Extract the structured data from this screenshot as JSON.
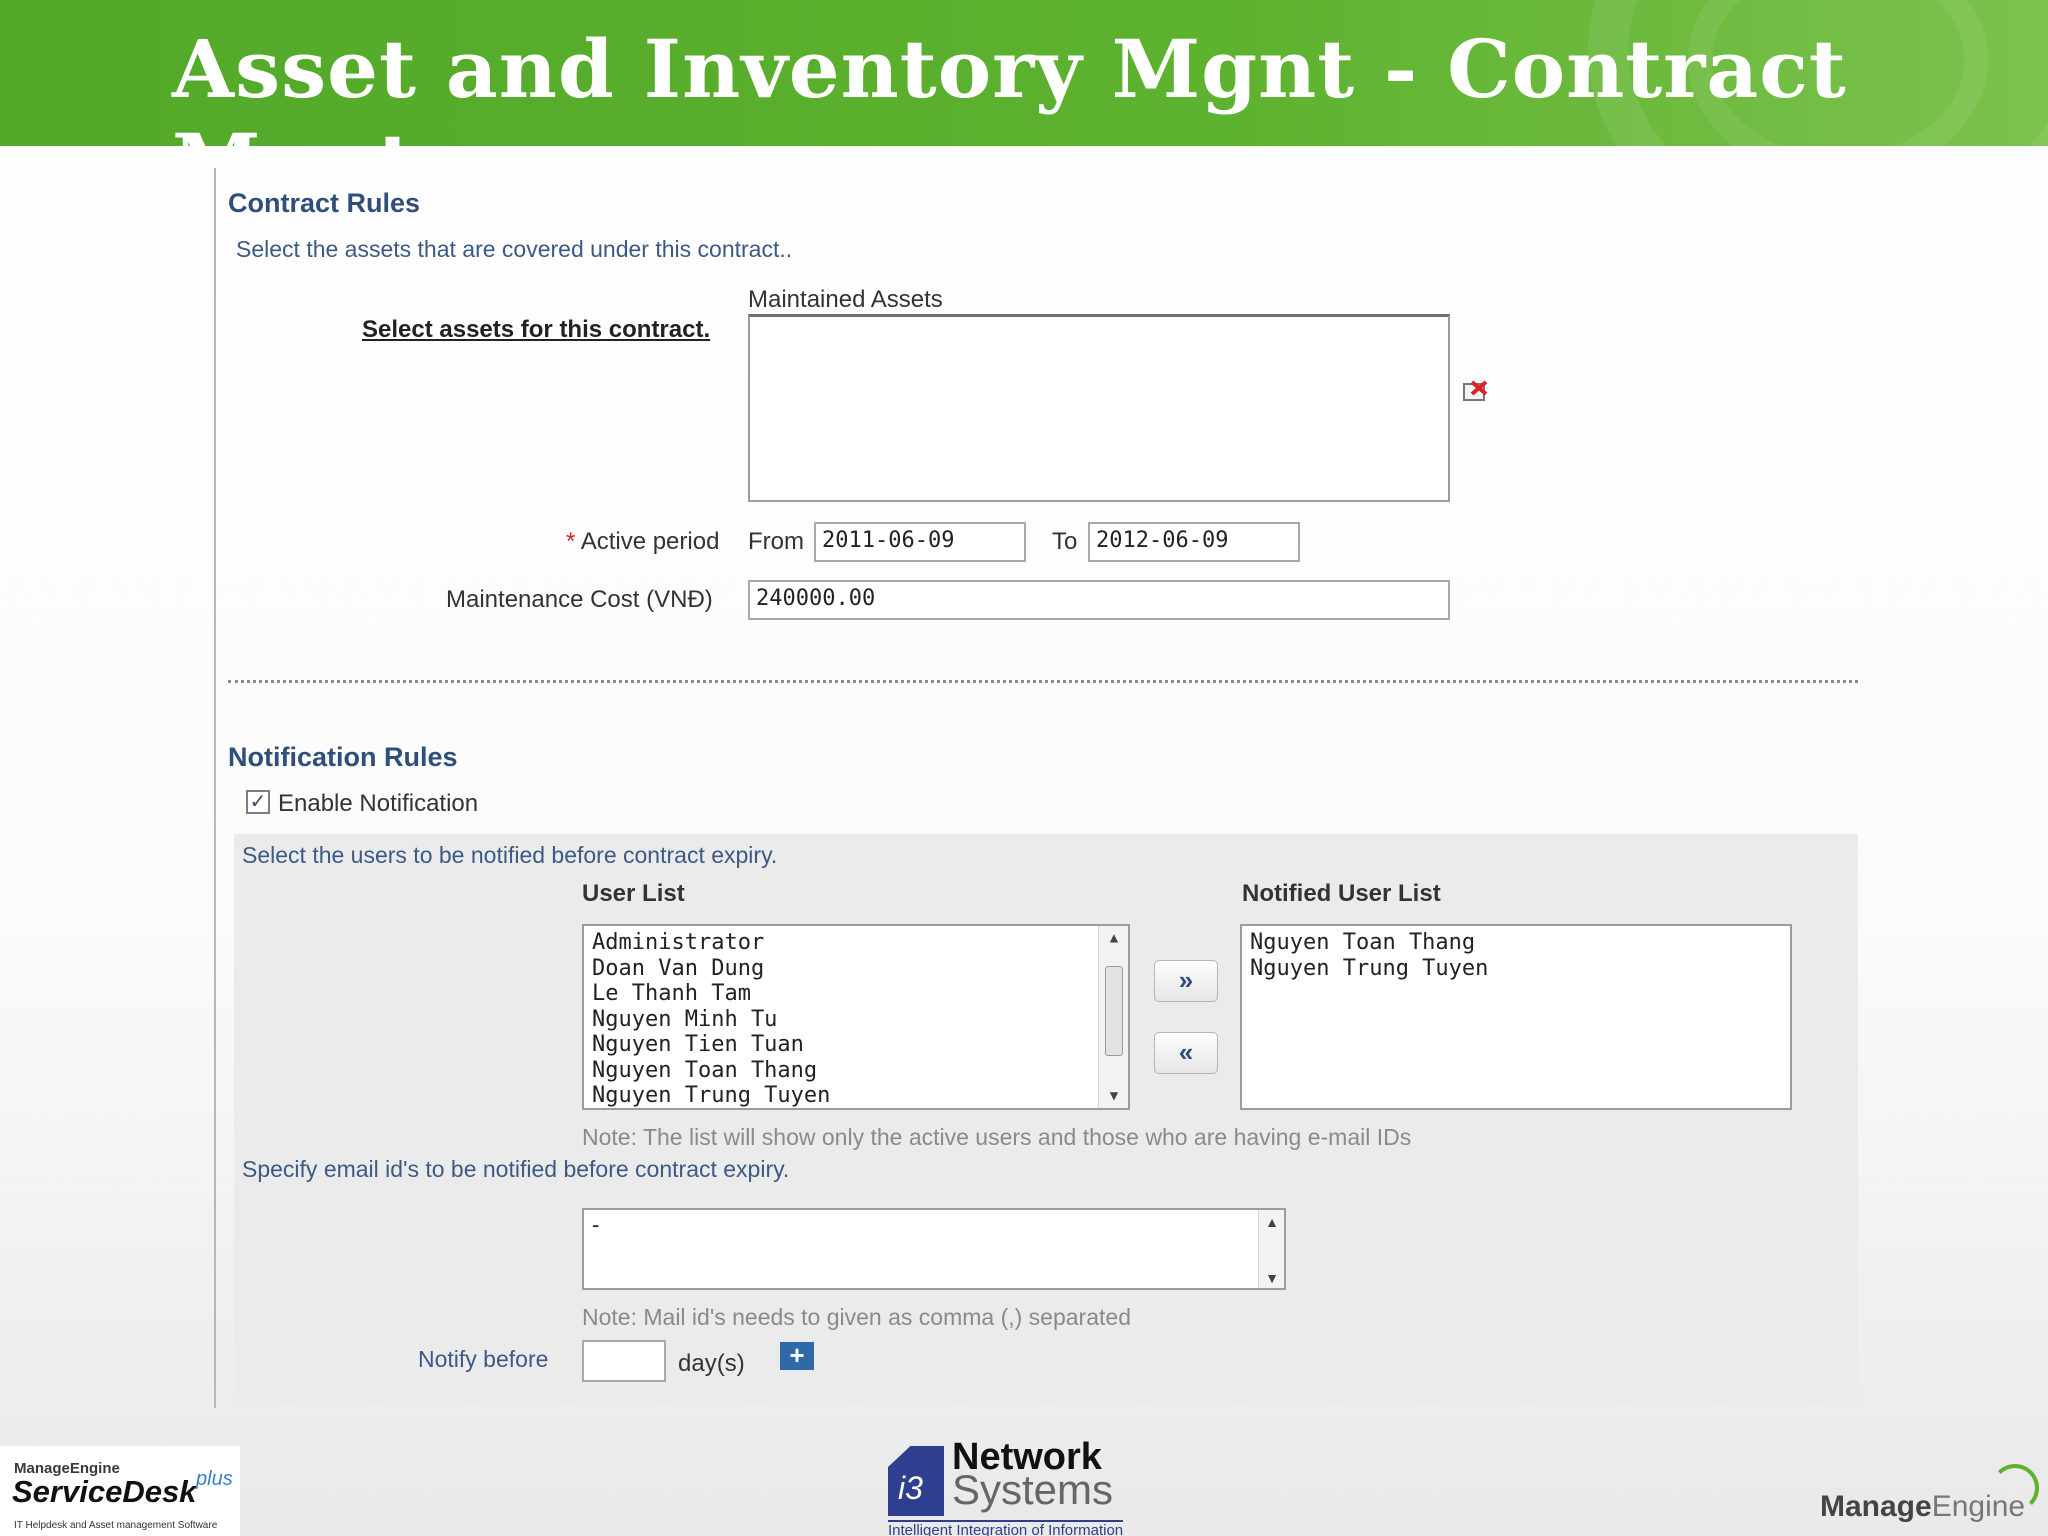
{
  "slide": {
    "title": "Asset and Inventory Mgnt - Contract Mgnt"
  },
  "contract_rules": {
    "title": "Contract Rules",
    "subtitle": "Select the assets that are covered under this contract..",
    "select_assets_label": "Select assets for this contract.",
    "maintained_assets_label": "Maintained Assets",
    "maintained_assets": [],
    "active_period": {
      "required_mark": "*",
      "label": "Active period",
      "from_label": "From",
      "from_value": "2011-06-09",
      "to_label": "To",
      "to_value": "2012-06-09"
    },
    "maintenance_cost": {
      "label": "Maintenance Cost (VNĐ)",
      "value": "240000.00"
    },
    "remove_asset_icon": "remove-icon"
  },
  "notification_rules": {
    "title": "Notification Rules",
    "enable_label": "Enable Notification",
    "enabled": true,
    "select_users_text": "Select the users to be notified before contract expiry.",
    "user_list_title": "User List",
    "user_list": [
      "Administrator",
      "Doan Van Dung",
      "Le Thanh Tam",
      "Nguyen Minh Tu",
      "Nguyen Tien Tuan",
      "Nguyen Toan Thang",
      "Nguyen Trung Tuyen"
    ],
    "notified_list_title": "Notified User List",
    "notified_list": [
      "Nguyen Toan Thang",
      "Nguyen Trung Tuyen"
    ],
    "add_button_label": "»",
    "remove_button_label": "«",
    "list_note": "Note: The list will show only the active users and those who are having e-mail IDs",
    "email_text": "Specify email id's to be notified before contract expiry.",
    "email_value": "-",
    "email_note": "Note: Mail id's needs to given as comma (,) separated",
    "notify_before_label": "Notify before",
    "notify_before_value": "",
    "days_label": "day(s)",
    "plus_label": "+"
  },
  "footer": {
    "servicedesk_vendor": "ManageEngine",
    "servicedesk_product": "ServiceDesk",
    "servicedesk_plus": "plus",
    "servicedesk_tagline": "IT Helpdesk and Asset management Software",
    "partner_mark": "i3",
    "partner_name_top": "Network",
    "partner_name_bottom": "Systems",
    "partner_tagline": "Intelligent Integration of Information",
    "vendor_manage": "Manage",
    "vendor_engine": "Engine"
  },
  "colors": {
    "banner_green": "#5db22f",
    "section_blue": "#2f4f7a",
    "link_blue": "#3c5a86",
    "plus_button": "#2e6aa8"
  }
}
